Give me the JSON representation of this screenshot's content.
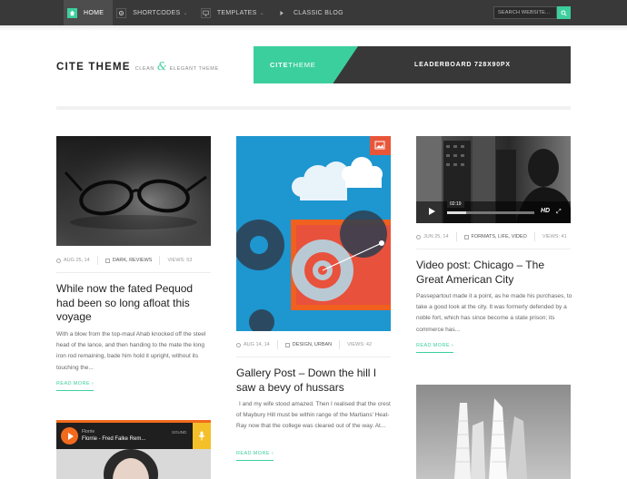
{
  "nav": {
    "items": [
      {
        "label": "Home",
        "icon": "home-icon",
        "active": true
      },
      {
        "label": "Shortcodes",
        "icon": "gear-icon",
        "has_caret": true
      },
      {
        "label": "Templates",
        "icon": "monitor-icon",
        "has_caret": true
      },
      {
        "label": "Classic Blog",
        "icon": "arrow-right-icon"
      }
    ],
    "search_placeholder": "SEARCH WEBSITE...",
    "search_icon": "search-icon"
  },
  "header": {
    "logo_main": "CITE THEME",
    "logo_sub_left": "CLEAN",
    "logo_amp": "&",
    "logo_sub_right": "ELEGANT THEME",
    "banner_logo_bold": "CITE",
    "banner_logo_light": "THEME",
    "banner_text": "LEADERBOARD 728X90PX"
  },
  "colors": {
    "accent": "#3ccf9e",
    "nav_bg": "#393939",
    "banner_dark": "#383838"
  },
  "posts": {
    "p1": {
      "date": "AUG 25, 14",
      "categories": "DARK, REVIEWS",
      "views": "VIEWS: 53",
      "title": "While now the fated Pequod had been so long afloat this voyage",
      "excerpt": "With a blow from the top-maul Ahab knocked off the steel head of the lance, and then handing to the mate the long iron rod remaining, bade him hold it upright, without its touching the...",
      "read_more": "READ MORE ›"
    },
    "p2": {
      "date": "AUG 14, 14",
      "categories": "DESIGN, URBAN",
      "views": "VIEWS: 42",
      "title": "Gallery Post – Down the hill I saw a bevy of hussars",
      "excerpt": "I and my wife stood amazed. Then I realised that the crest of Maybury Hill must be within range of the Martians' Heat-Ray now that the college was cleared out of the way. At...",
      "read_more": "READ MORE ›"
    },
    "p3": {
      "date": "JUN 25, 14",
      "categories": "FORMATS, LIFE, VIDEO",
      "views": "VIEWS: 41",
      "title": "Video post: Chicago – The Great American City",
      "excerpt": "Passepartout made it a point, as he made his purchases, to take a good look at the city. It was formerly defended by a noble fort, which has since become a state prison; its commerce has...",
      "read_more": "READ MORE ›",
      "video_time": "02:19",
      "video_hd": "HD"
    },
    "p4": {
      "player_artist": "Florrie",
      "player_track": "Florrie - Fred Falke Rem...",
      "player_label": "SOUND"
    }
  }
}
